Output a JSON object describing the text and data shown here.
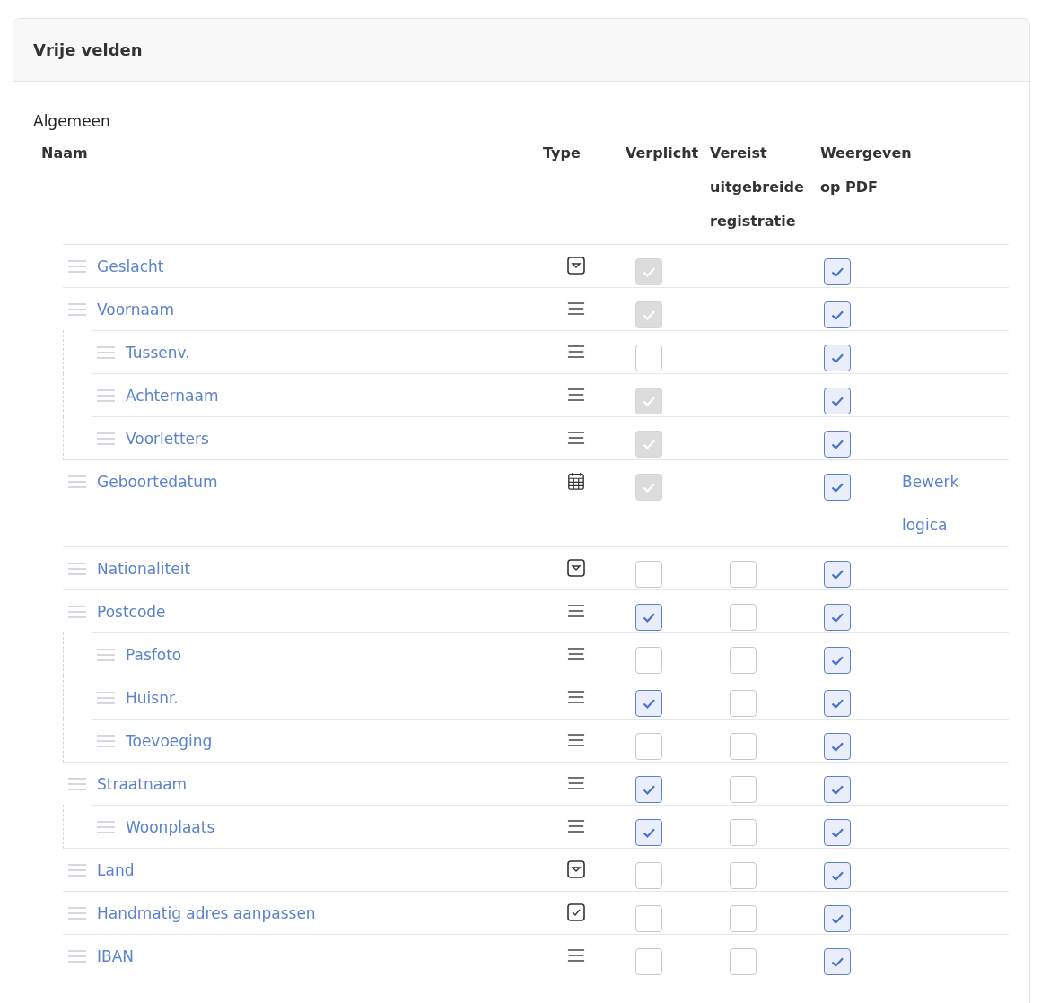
{
  "card": {
    "title": "Vrije velden"
  },
  "section": "Algemeen",
  "columns": [
    {
      "label": "Naam"
    },
    {
      "label": "Type"
    },
    {
      "label": "Verplicht"
    },
    {
      "label": "Vereist uitgebreide registratie"
    },
    {
      "label": "Weergeven op PDF"
    }
  ],
  "fields": [
    {
      "name": "Geslacht",
      "kind": "select",
      "required": {
        "checked": true,
        "disabled": true
      },
      "pdf": {
        "checked": true
      }
    },
    {
      "name": "Voornaam",
      "kind": "text",
      "required": {
        "checked": true,
        "disabled": true
      },
      "pdf": {
        "checked": true
      },
      "children": [
        {
          "name": "Tussenv.",
          "kind": "text",
          "required": {
            "checked": false,
            "disabled": false
          },
          "pdf": {
            "checked": true
          }
        },
        {
          "name": "Achternaam",
          "kind": "text",
          "required": {
            "checked": true,
            "disabled": true
          },
          "pdf": {
            "checked": true
          }
        },
        {
          "name": "Voorletters",
          "kind": "text",
          "required": {
            "checked": true,
            "disabled": true
          },
          "pdf": {
            "checked": true
          }
        }
      ]
    },
    {
      "name": "Geboortedatum",
      "kind": "date",
      "required": {
        "checked": true,
        "disabled": true
      },
      "pdf": {
        "checked": true
      },
      "link": "Bewerk logica"
    },
    {
      "name": "Nationaliteit",
      "kind": "select",
      "required": {
        "checked": false,
        "disabled": false
      },
      "extended": {
        "checked": false
      },
      "pdf": {
        "checked": true
      }
    },
    {
      "name": "Postcode",
      "kind": "text",
      "required": {
        "checked": true,
        "disabled": false
      },
      "extended": {
        "checked": false
      },
      "pdf": {
        "checked": true
      },
      "children": [
        {
          "name": "Pasfoto",
          "kind": "text",
          "required": {
            "checked": false,
            "disabled": false
          },
          "extended": {
            "checked": false
          },
          "pdf": {
            "checked": true
          }
        },
        {
          "name": "Huisnr.",
          "kind": "text",
          "required": {
            "checked": true,
            "disabled": false
          },
          "extended": {
            "checked": false
          },
          "pdf": {
            "checked": true
          }
        },
        {
          "name": "Toevoeging",
          "kind": "text",
          "required": {
            "checked": false,
            "disabled": false
          },
          "extended": {
            "checked": false
          },
          "pdf": {
            "checked": true
          }
        }
      ]
    },
    {
      "name": "Straatnaam",
      "kind": "text",
      "required": {
        "checked": true,
        "disabled": false
      },
      "extended": {
        "checked": false
      },
      "pdf": {
        "checked": true
      },
      "children": [
        {
          "name": "Woonplaats",
          "kind": "text",
          "required": {
            "checked": true,
            "disabled": false
          },
          "extended": {
            "checked": false
          },
          "pdf": {
            "checked": true
          }
        }
      ]
    },
    {
      "name": "Land",
      "kind": "select",
      "required": {
        "checked": false,
        "disabled": false
      },
      "extended": {
        "checked": false
      },
      "pdf": {
        "checked": true
      }
    },
    {
      "name": "Handmatig adres aanpassen",
      "kind": "checkbox",
      "required": {
        "checked": false,
        "disabled": false
      },
      "extended": {
        "checked": false
      },
      "pdf": {
        "checked": true
      }
    },
    {
      "name": "IBAN",
      "kind": "text",
      "required": {
        "checked": false,
        "disabled": false
      },
      "extended": {
        "checked": false
      },
      "pdf": {
        "checked": true
      }
    }
  ]
}
